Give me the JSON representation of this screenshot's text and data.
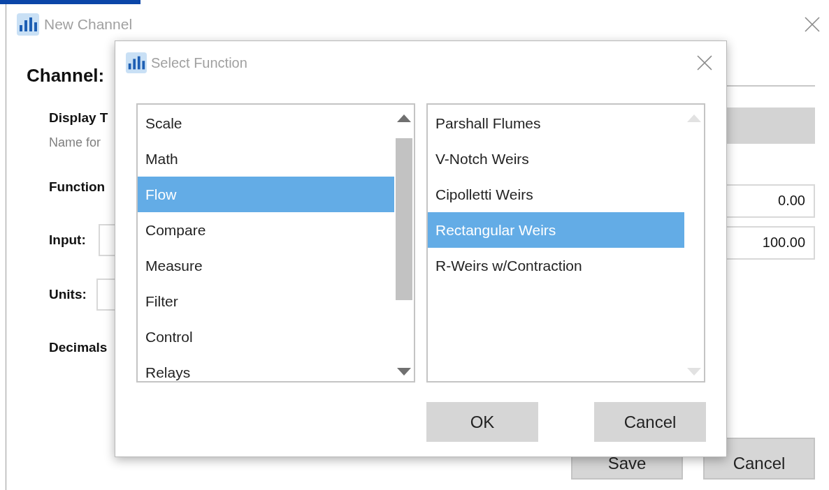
{
  "window": {
    "title": "New Channel"
  },
  "heading": "Channel:",
  "form": {
    "display_label": "Display T",
    "display_hint": "Name for",
    "function_label": "Function",
    "input_label": "Input:",
    "units_label": "Units:",
    "decimals_label": "Decimals",
    "range_min": "0.00",
    "range_max": "100.00"
  },
  "buttons": [
    "Save",
    "Cancel"
  ],
  "dialog": {
    "title": "Select Function",
    "categories": [
      {
        "label": "Scale",
        "selected": false
      },
      {
        "label": "Math",
        "selected": false
      },
      {
        "label": "Flow",
        "selected": true
      },
      {
        "label": "Compare",
        "selected": false
      },
      {
        "label": "Measure",
        "selected": false
      },
      {
        "label": "Filter",
        "selected": false
      },
      {
        "label": "Control",
        "selected": false
      },
      {
        "label": "Relays",
        "selected": false
      }
    ],
    "functions": [
      {
        "label": "Parshall Flumes",
        "selected": false
      },
      {
        "label": "V-Notch Weirs",
        "selected": false
      },
      {
        "label": "Cipolletti Weirs",
        "selected": false
      },
      {
        "label": "Rectangular Weirs",
        "selected": true
      },
      {
        "label": "R-Weirs w/Contraction",
        "selected": false
      }
    ],
    "buttons": [
      "OK",
      "Cancel"
    ]
  }
}
